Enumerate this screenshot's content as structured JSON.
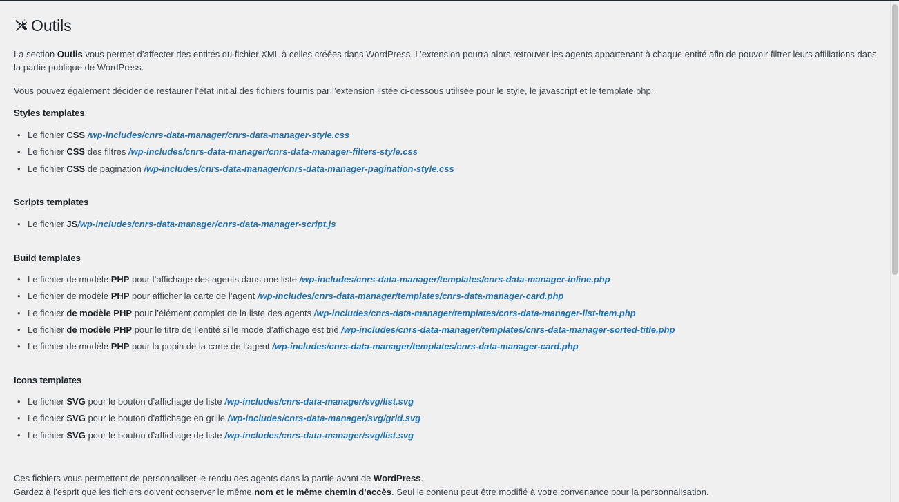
{
  "title": "Outils",
  "intro": {
    "p1_a": "La section ",
    "p1_b": "Outils",
    "p1_c": " vous permet d’affecter des entités du fichier XML à celles créées dans WordPress. L’extension pourra alors retrouver les agents appartenant à chaque entité afin de pouvoir filtrer leurs affiliations dans la partie publique de WordPress.",
    "p2": "Vous pouvez également décider de restaurer l’état initial des fichiers fournis par l’extension listée ci-dessous utilisée pour le style, le javascript et le template php:"
  },
  "styles": {
    "title": "Styles templates",
    "items": [
      {
        "pre": "Le fichier ",
        "bold": "CSS",
        "mid": " ",
        "link": "/wp-includes/cnrs-data-manager/cnrs-data-manager-style.css"
      },
      {
        "pre": "Le fichier ",
        "bold": "CSS",
        "mid": " des filtres ",
        "link": "/wp-includes/cnrs-data-manager/cnrs-data-manager-filters-style.css"
      },
      {
        "pre": "Le fichier ",
        "bold": "CSS",
        "mid": " de pagination ",
        "link": "/wp-includes/cnrs-data-manager/cnrs-data-manager-pagination-style.css"
      }
    ]
  },
  "scripts": {
    "title": "Scripts templates",
    "items": [
      {
        "pre": "Le fichier ",
        "bold": "JS",
        "mid": "",
        "link": "/wp-includes/cnrs-data-manager/cnrs-data-manager-script.js"
      }
    ]
  },
  "build": {
    "title": "Build templates",
    "items": [
      {
        "pre": "Le fichier de modèle ",
        "bold": "PHP",
        "mid": " pour l’affichage des agents dans une liste ",
        "link": "/wp-includes/cnrs-data-manager/templates/cnrs-data-manager-inline.php"
      },
      {
        "pre": "Le fichier de modèle ",
        "bold": "PHP",
        "mid": " pour afficher la carte de l’agent ",
        "link": "/wp-includes/cnrs-data-manager/templates/cnrs-data-manager-card.php"
      },
      {
        "pre": "Le fichier ",
        "bold": "de modèle PHP",
        "mid": " pour l’élément complet de la liste des agents ",
        "link": "/wp-includes/cnrs-data-manager/templates/cnrs-data-manager-list-item.php"
      },
      {
        "pre": "Le fichier ",
        "bold": "de modèle PHP",
        "mid": " pour le titre de l’entité si le mode d’affichage est trié ",
        "link": "/wp-includes/cnrs-data-manager/templates/cnrs-data-manager-sorted-title.php"
      },
      {
        "pre": "Le fichier de modèle ",
        "bold": "PHP",
        "mid": " pour la popin de la carte de l’agent ",
        "link": "/wp-includes/cnrs-data-manager/templates/cnrs-data-manager-card.php"
      }
    ]
  },
  "icons": {
    "title": "Icons templates",
    "items": [
      {
        "pre": "Le fichier ",
        "bold": "SVG",
        "mid": " pour le bouton d’affichage de liste ",
        "link": "/wp-includes/cnrs-data-manager/svg/list.svg"
      },
      {
        "pre": "Le fichier ",
        "bold": "SVG",
        "mid": " pour le bouton d’affichage en grille ",
        "link": "/wp-includes/cnrs-data-manager/svg/grid.svg"
      },
      {
        "pre": "Le fichier ",
        "bold": "SVG",
        "mid": " pour le bouton d’affichage de liste ",
        "link": "/wp-includes/cnrs-data-manager/svg/list.svg"
      }
    ]
  },
  "footer": {
    "f1_a": "Ces fichiers vous permettent de personnaliser le rendu des agents dans la partie avant de ",
    "f1_b": "WordPress",
    "f1_c": ".",
    "f2_a": "Gardez à l’esprit que les fichiers doivent conserver le même ",
    "f2_b": "nom et le même chemin d’accès",
    "f2_c": ". Seul le contenu peut être modifié à votre convenance pour la personnalisation."
  }
}
